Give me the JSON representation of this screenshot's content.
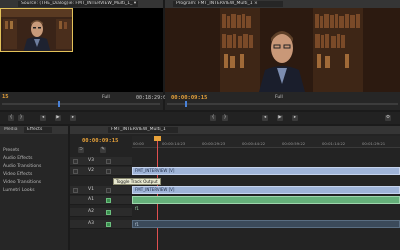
{
  "source_monitor": {
    "tab_label": "Source: (THE_Dialog)ie: FMT_INTERVIEW_Multi_1_ ▾ ×",
    "timecode_in": "15",
    "fit": "Full",
    "duration": "00:18:29:06"
  },
  "program_monitor": {
    "tab_label": "Program: FMT_INTERVIEW_Multi_1 ×",
    "timecode": "00:00:09:15",
    "fit": "Full"
  },
  "project_panel": {
    "tabs": [
      "Media",
      "Effects"
    ],
    "items": [
      "Presets",
      "Audio Effects",
      "Audio Transitions",
      "Video Effects",
      "Video Transitions",
      "Lumetri Looks"
    ]
  },
  "timeline": {
    "tab_label": "FMT_INTERVIEW_Multi_1",
    "timecode": "00:00:09:15",
    "ruler_ticks": [
      "00:00",
      "00:00:14:23",
      "00:00:29:23",
      "00:00:44:22",
      "00:00:59:22",
      "00:01:14:22",
      "00:01:29:21"
    ],
    "video_tracks": [
      "V3",
      "V2",
      "V1"
    ],
    "audio_tracks": [
      "A1",
      "A2",
      "A3"
    ],
    "clip_v2": "FMT_INTERVIEW [V]",
    "clip_v1": "FMT_INTERVIEW [V]",
    "tooltip": "Toggle Track Output",
    "audio_marker": "f1",
    "audio_marker2": "f1"
  },
  "colors": {
    "timecode_accent": "#e8a23a",
    "video_clip": "#9fb4d8",
    "audio_clip": "#65b07a",
    "selection": "#e3c25a"
  },
  "icons": [
    "play-icon",
    "step-back-icon",
    "step-forward-icon",
    "mark-in-icon",
    "mark-out-icon",
    "settings-icon",
    "wrench-icon",
    "snap-icon",
    "eye-icon",
    "lock-icon",
    "speaker-icon"
  ]
}
